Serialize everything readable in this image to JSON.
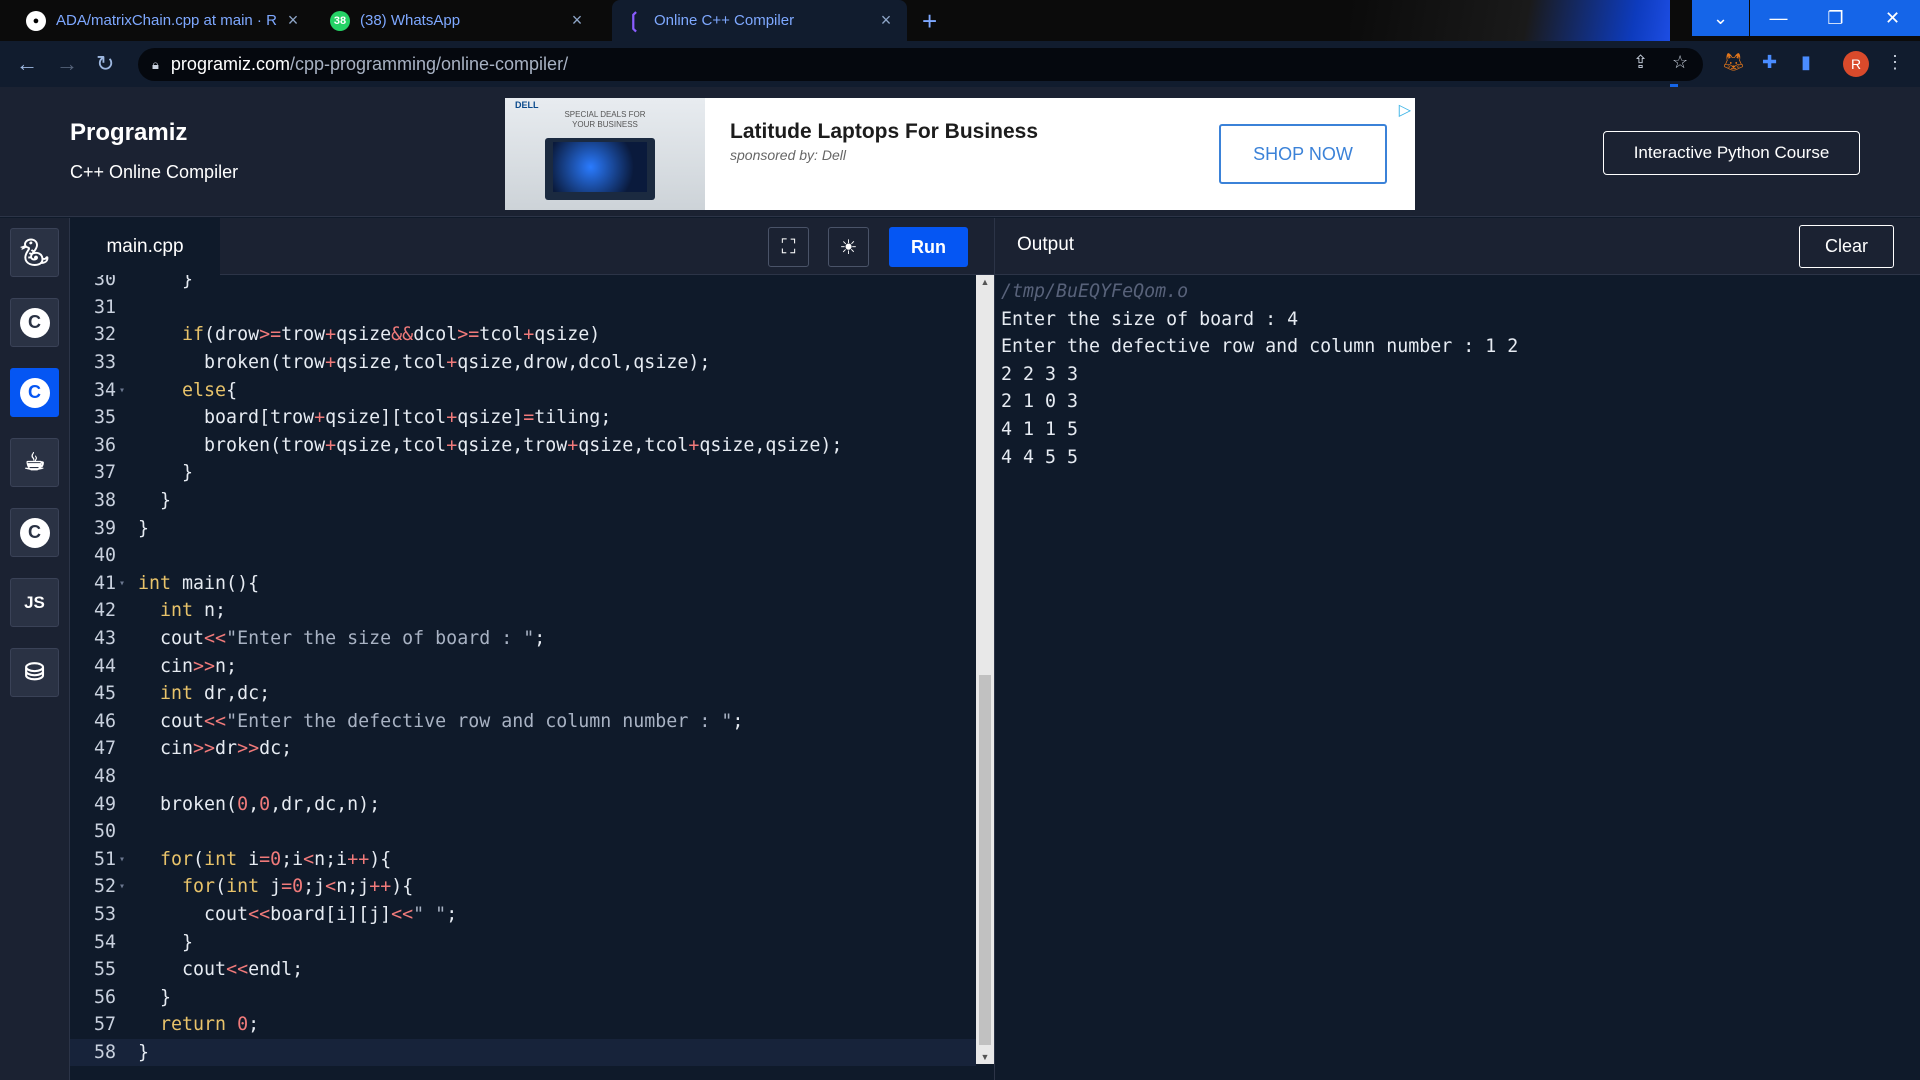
{
  "browser": {
    "tabs": [
      {
        "title": "ADA/matrixChain.cpp at main · R",
        "icon": "github-icon"
      },
      {
        "title": "(38) WhatsApp",
        "icon": "whatsapp-icon",
        "badge": "38"
      },
      {
        "title": "Online C++ Compiler",
        "icon": "programiz-icon"
      }
    ],
    "new_tab": "+",
    "url_host": "programiz.com",
    "url_path": "/cpp-programming/online-compiler/",
    "profile_initial": "R"
  },
  "header": {
    "logo": "Programiz",
    "subtitle": "C++ Online Compiler",
    "course_button": "Interactive Python Course"
  },
  "ad": {
    "brand": "DELL",
    "deals_text": "SPECIAL DEALS FOR YOUR BUSINESS",
    "title": "Latitude Laptops For Business",
    "sponsor": "sponsored by: Dell",
    "cta": "SHOP NOW"
  },
  "sidebar": {
    "languages": [
      "Python",
      "C",
      "C++",
      "Java",
      "C#",
      "JS",
      "SQL"
    ],
    "js_label": "JS",
    "active": "C++"
  },
  "editor": {
    "filename": "main.cpp",
    "run_label": "Run",
    "fullscreen_icon": "fullscreen-icon",
    "theme_icon": "sun-icon",
    "lines": [
      {
        "n": "30",
        "text": "    }"
      },
      {
        "n": "31",
        "text": ""
      },
      {
        "n": "32",
        "text": "    if(drow>=trow+qsize&&dcol>=tcol+qsize)"
      },
      {
        "n": "33",
        "text": "      broken(trow+qsize,tcol+qsize,drow,dcol,qsize);"
      },
      {
        "n": "34",
        "text": "    else{"
      },
      {
        "n": "35",
        "text": "      board[trow+qsize][tcol+qsize]=tiling;"
      },
      {
        "n": "36",
        "text": "      broken(trow+qsize,tcol+qsize,trow+qsize,tcol+qsize,qsize);"
      },
      {
        "n": "37",
        "text": "    }"
      },
      {
        "n": "38",
        "text": "  }"
      },
      {
        "n": "39",
        "text": "}"
      },
      {
        "n": "40",
        "text": ""
      },
      {
        "n": "41",
        "text": "int main(){"
      },
      {
        "n": "42",
        "text": "  int n;"
      },
      {
        "n": "43",
        "text": "  cout<<\"Enter the size of board : \";"
      },
      {
        "n": "44",
        "text": "  cin>>n;"
      },
      {
        "n": "45",
        "text": "  int dr,dc;"
      },
      {
        "n": "46",
        "text": "  cout<<\"Enter the defective row and column number : \";"
      },
      {
        "n": "47",
        "text": "  cin>>dr>>dc;"
      },
      {
        "n": "48",
        "text": ""
      },
      {
        "n": "49",
        "text": "  broken(0,0,dr,dc,n);"
      },
      {
        "n": "50",
        "text": ""
      },
      {
        "n": "51",
        "text": "  for(int i=0;i<n;i++){"
      },
      {
        "n": "52",
        "text": "    for(int j=0;j<n;j++){"
      },
      {
        "n": "53",
        "text": "      cout<<board[i][j]<<\" \";"
      },
      {
        "n": "54",
        "text": "    }"
      },
      {
        "n": "55",
        "text": "    cout<<endl;"
      },
      {
        "n": "56",
        "text": "  }"
      },
      {
        "n": "57",
        "text": "  return 0;"
      },
      {
        "n": "58",
        "text": "}"
      }
    ]
  },
  "output": {
    "title": "Output",
    "clear_label": "Clear",
    "lines": [
      "/tmp/BuEQYFeQom.o",
      "Enter the size of board : 4",
      "Enter the defective row and column number : 1 2",
      "2 2 3 3",
      "2 1 0 3",
      "4 1 1 5",
      "4 4 5 5"
    ]
  },
  "colors": {
    "accent": "#0556f3",
    "background": "#0f1a2a",
    "panel": "#1b2232"
  }
}
